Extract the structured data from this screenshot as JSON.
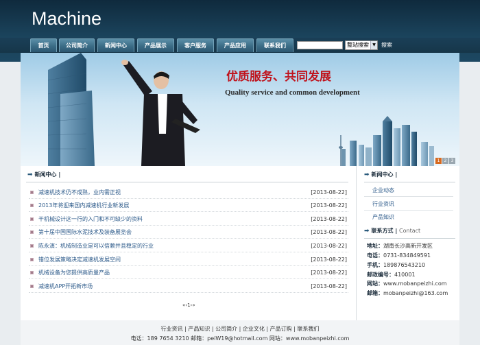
{
  "logo": "Machine",
  "nav": [
    "首页",
    "公司简介",
    "新闻中心",
    "产品展示",
    "客户服务",
    "产品应用",
    "联系我们"
  ],
  "search": {
    "placeholder": "",
    "select_value": "整站搜索",
    "button_label": "搜索"
  },
  "banner": {
    "title": "优质服务、共同发展",
    "subtitle": "Quality service and common development",
    "dots": [
      "1",
      "2",
      "3"
    ]
  },
  "news": {
    "heading": "新闻中心",
    "items": [
      {
        "title": "减速机技术仍不成熟，业内需正视",
        "date": "[2013-08-22]"
      },
      {
        "title": "2013年将迎来国内减速机行业新发展",
        "date": "[2013-08-22]"
      },
      {
        "title": "干机械设计这一行的入门和不可缺少的资料",
        "date": "[2013-08-22]"
      },
      {
        "title": "第十届中国国际水泥技术及装备展览会",
        "date": "[2013-08-22]"
      },
      {
        "title": "陈永演：机械制造业是可以信赖并且稳定的行业",
        "date": "[2013-08-22]"
      },
      {
        "title": "错位发展策略决定减速机发展空间",
        "date": "[2013-08-22]"
      },
      {
        "title": "机械设备为您提供高质量产品",
        "date": "[2013-08-22]"
      },
      {
        "title": "减速机APP开拓新市场",
        "date": "[2013-08-22]"
      }
    ],
    "pager": "«‹1›»"
  },
  "side_news": {
    "heading": "新闻中心",
    "links": [
      "企业动态",
      "行业资讯",
      "产品知识"
    ]
  },
  "contact": {
    "heading": "联系方式",
    "heading_en": "Contact",
    "rows": [
      {
        "label": "地址：",
        "value": "湖南长沙高新开发区"
      },
      {
        "label": "电话：",
        "value": "0731-834849591"
      },
      {
        "label": "手机：",
        "value": "189876543210"
      },
      {
        "label": "邮政编号：",
        "value": "410001"
      },
      {
        "label": "网站：",
        "value": "www.mobanpeizhi.com"
      },
      {
        "label": "邮箱：",
        "value": "mobanpeizhi@163.com"
      }
    ]
  },
  "footer": {
    "links": [
      "行业资讯",
      "产品知识",
      "公司简介",
      "企业文化",
      "产品订购",
      "联系我们"
    ],
    "contact_line": "电话：189 7654 3210 邮箱：peiW19@hotmail.com 网站：www.mobanpeizhi.com"
  },
  "colors": {
    "banner_title": "#c0121b",
    "link": "#2c5a8a",
    "header_bg": "#143246"
  }
}
